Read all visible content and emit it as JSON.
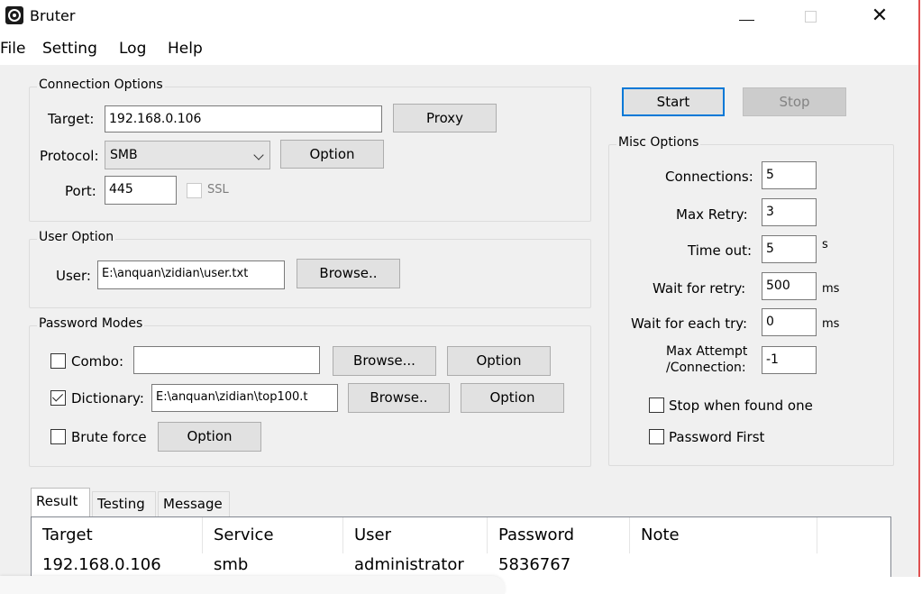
{
  "window": {
    "title": "Bruter"
  },
  "menu": [
    "File",
    "Setting",
    "Log",
    "Help"
  ],
  "connection": {
    "title": "Connection Options",
    "target_label": "Target:",
    "target_value": "192.168.0.106",
    "proxy_label": "Proxy",
    "protocol_label": "Protocol:",
    "protocol_value": "SMB",
    "option_label": "Option",
    "port_label": "Port:",
    "port_value": "445",
    "ssl_label": "SSL",
    "ssl_checked": false
  },
  "user_option": {
    "title": "User Option",
    "user_label": "User:",
    "user_value": "E:\\anquan\\zidian\\user.txt",
    "browse_label": "Browse.."
  },
  "password_modes": {
    "title": "Password Modes",
    "combo_label": "Combo:",
    "combo_value": "",
    "combo_browse": "Browse...",
    "combo_option": "Option",
    "combo_checked": false,
    "dictionary_label": "Dictionary:",
    "dictionary_value": "E:\\anquan\\zidian\\top100.t",
    "dictionary_browse": "Browse..",
    "dictionary_option": "Option",
    "dictionary_checked": true,
    "brute_label": "Brute force",
    "brute_option": "Option",
    "brute_checked": false
  },
  "actions": {
    "start_label": "Start",
    "stop_label": "Stop"
  },
  "misc": {
    "title": "Misc Options",
    "connections_label": "Connections:",
    "connections_value": "5",
    "max_retry_label": "Max Retry:",
    "max_retry_value": "3",
    "timeout_label": "Time out:",
    "timeout_value": "5",
    "timeout_unit": "s",
    "wait_retry_label": "Wait for retry:",
    "wait_retry_value": "500",
    "wait_retry_unit": "ms",
    "wait_each_label": "Wait for each try:",
    "wait_each_value": "0",
    "wait_each_unit": "ms",
    "max_attempt_label_1": "Max Attempt",
    "max_attempt_label_2": "/Connection:",
    "max_attempt_value": "-1",
    "stop_found_label": "Stop when found one",
    "password_first_label": "Password First"
  },
  "tabs": [
    "Result",
    "Testing",
    "Message"
  ],
  "results": {
    "columns": [
      "Target",
      "Service",
      "User",
      "Password",
      "Note"
    ],
    "rows": [
      [
        "192.168.0.106",
        "smb",
        "administrator",
        "5836767",
        ""
      ]
    ]
  }
}
